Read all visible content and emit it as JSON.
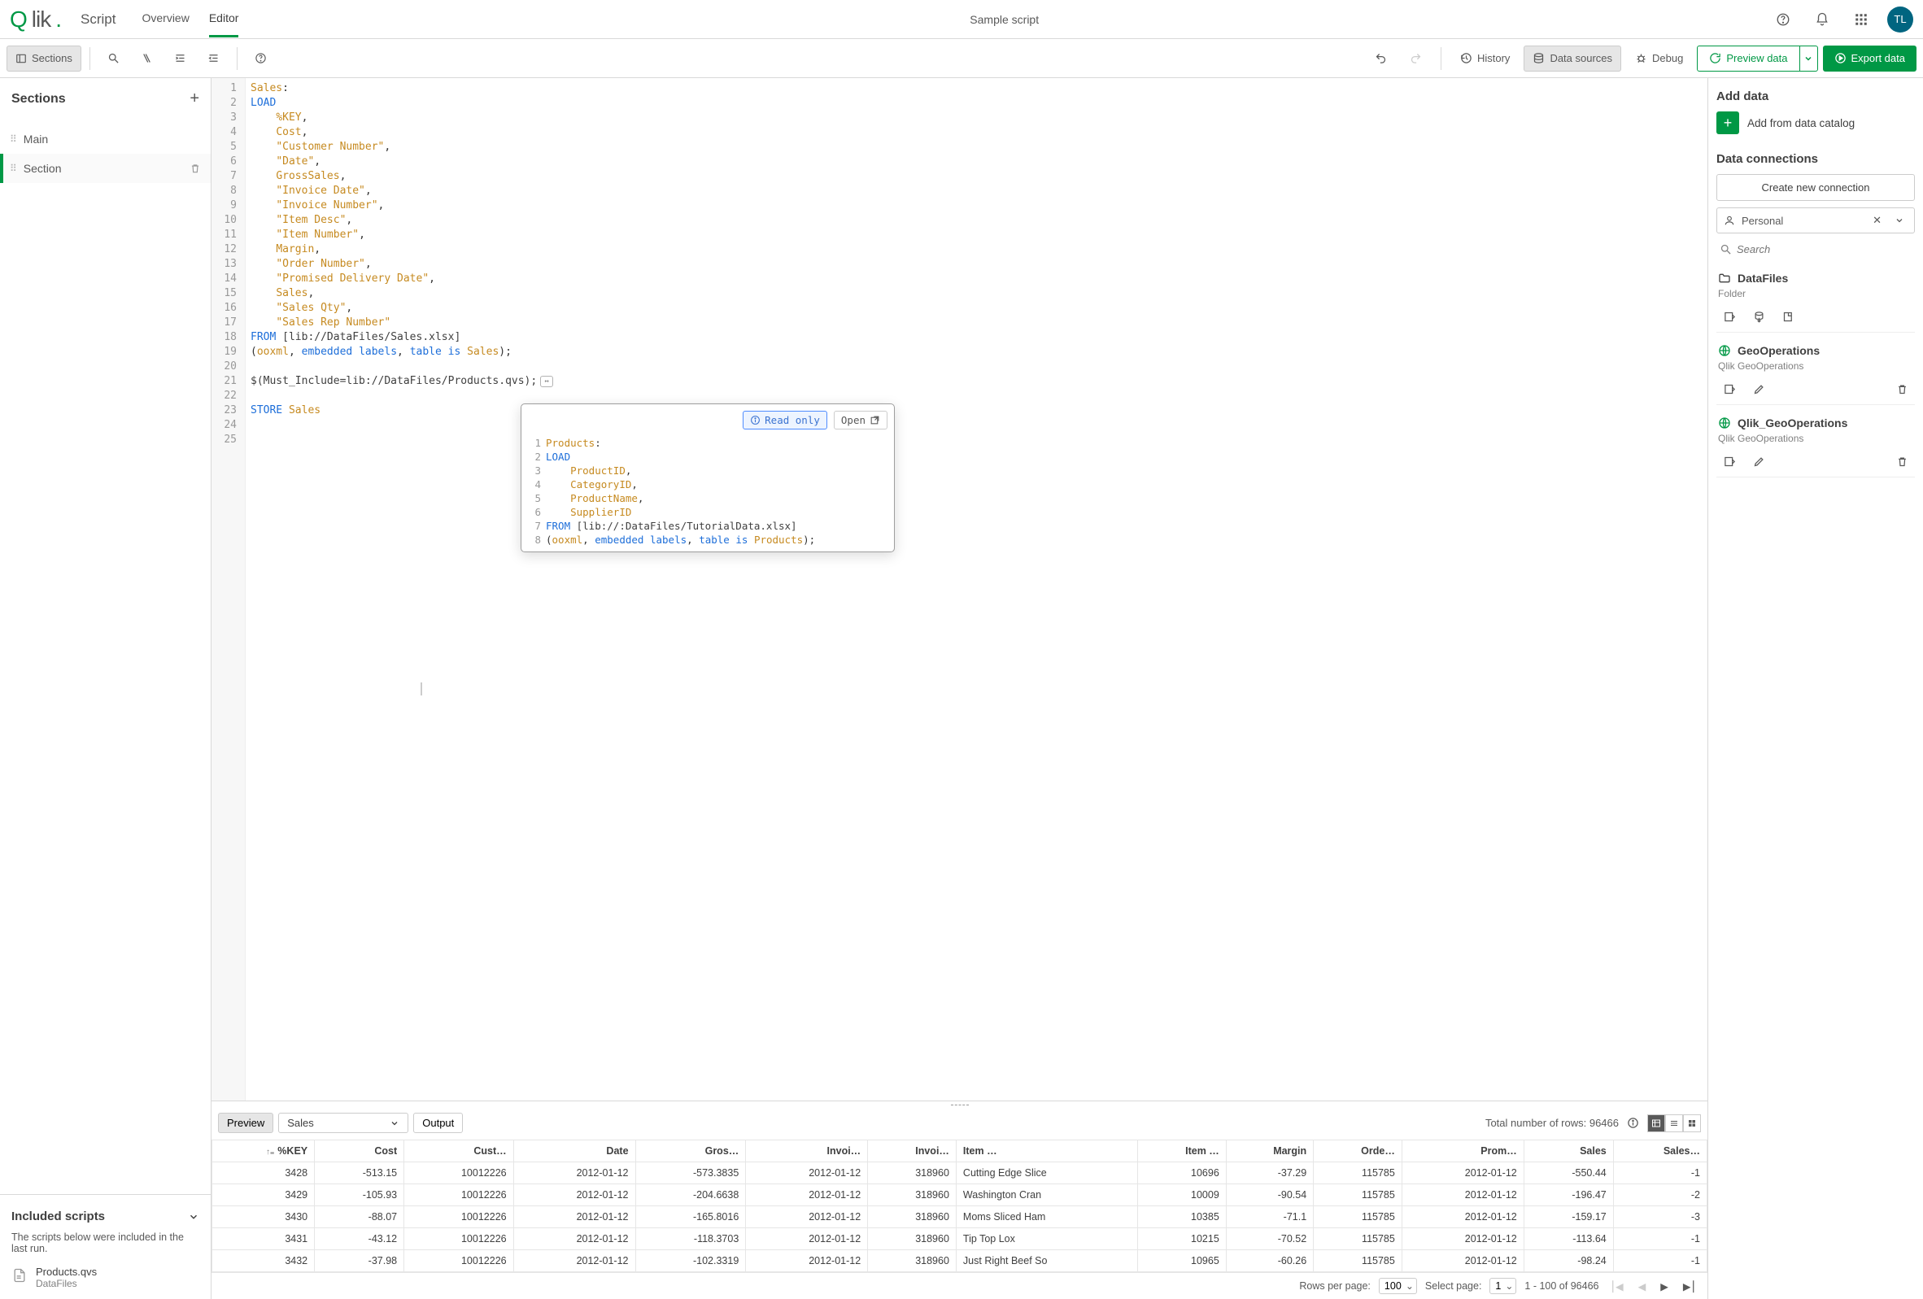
{
  "brand": {
    "q": "Q",
    "rest": "lik",
    "dot": "."
  },
  "script_label": "Script",
  "top_tabs": {
    "overview": "Overview",
    "editor": "Editor"
  },
  "page_title": "Sample script",
  "avatar": "TL",
  "toolbar": {
    "sections_btn": "Sections",
    "history": "History",
    "data_sources": "Data sources",
    "debug": "Debug",
    "preview_data": "Preview data",
    "export_data": "Export data"
  },
  "sections_panel": {
    "title": "Sections",
    "items": [
      "Main",
      "Section"
    ]
  },
  "included": {
    "title": "Included scripts",
    "desc": "The scripts below were included in the last run.",
    "item_name": "Products.qvs",
    "item_sub": "DataFiles"
  },
  "editor_lines": [
    [
      [
        "ident",
        "Sales"
      ],
      [
        "punct",
        ":"
      ]
    ],
    [
      [
        "kw",
        "LOAD"
      ]
    ],
    [
      [
        "",
        "    "
      ],
      [
        "ident",
        "%KEY"
      ],
      [
        "punct",
        ","
      ]
    ],
    [
      [
        "",
        "    "
      ],
      [
        "ident",
        "Cost"
      ],
      [
        "punct",
        ","
      ]
    ],
    [
      [
        "",
        "    "
      ],
      [
        "str",
        "\"Customer Number\""
      ],
      [
        "punct",
        ","
      ]
    ],
    [
      [
        "",
        "    "
      ],
      [
        "str",
        "\"Date\""
      ],
      [
        "punct",
        ","
      ]
    ],
    [
      [
        "",
        "    "
      ],
      [
        "ident",
        "GrossSales"
      ],
      [
        "punct",
        ","
      ]
    ],
    [
      [
        "",
        "    "
      ],
      [
        "str",
        "\"Invoice Date\""
      ],
      [
        "punct",
        ","
      ]
    ],
    [
      [
        "",
        "    "
      ],
      [
        "str",
        "\"Invoice Number\""
      ],
      [
        "punct",
        ","
      ]
    ],
    [
      [
        "",
        "    "
      ],
      [
        "str",
        "\"Item Desc\""
      ],
      [
        "punct",
        ","
      ]
    ],
    [
      [
        "",
        "    "
      ],
      [
        "str",
        "\"Item Number\""
      ],
      [
        "punct",
        ","
      ]
    ],
    [
      [
        "",
        "    "
      ],
      [
        "ident",
        "Margin"
      ],
      [
        "punct",
        ","
      ]
    ],
    [
      [
        "",
        "    "
      ],
      [
        "str",
        "\"Order Number\""
      ],
      [
        "punct",
        ","
      ]
    ],
    [
      [
        "",
        "    "
      ],
      [
        "str",
        "\"Promised Delivery Date\""
      ],
      [
        "punct",
        ","
      ]
    ],
    [
      [
        "",
        "    "
      ],
      [
        "ident",
        "Sales"
      ],
      [
        "punct",
        ","
      ]
    ],
    [
      [
        "",
        "    "
      ],
      [
        "str",
        "\"Sales Qty\""
      ],
      [
        "punct",
        ","
      ]
    ],
    [
      [
        "",
        "    "
      ],
      [
        "str",
        "\"Sales Rep Number\""
      ]
    ],
    [
      [
        "kw",
        "FROM"
      ],
      [
        "",
        " [lib://DataFiles/Sales.xlsx]"
      ]
    ],
    [
      [
        "punct",
        "("
      ],
      [
        "ident",
        "ooxml"
      ],
      [
        "punct",
        ", "
      ],
      [
        "kw",
        "embedded labels"
      ],
      [
        "punct",
        ", "
      ],
      [
        "kw",
        "table is"
      ],
      [
        "",
        " "
      ],
      [
        "ident",
        "Sales"
      ],
      [
        "punct",
        ");"
      ]
    ],
    [
      [
        "",
        ""
      ]
    ],
    [
      [
        "",
        "$(Must_Include=lib://DataFiles/Products.qvs);"
      ],
      [
        "@expand",
        ""
      ]
    ],
    [
      [
        "",
        ""
      ]
    ],
    [
      [
        "kw",
        "STORE"
      ],
      [
        "",
        " "
      ],
      [
        "ident",
        "Sales"
      ]
    ],
    [
      [
        "",
        ""
      ]
    ],
    [
      [
        "",
        ""
      ]
    ]
  ],
  "popover": {
    "read_only": "Read only",
    "open": "Open",
    "lines": [
      [
        [
          "ident",
          "Products"
        ],
        [
          "punct",
          ":"
        ]
      ],
      [
        [
          "kw",
          "LOAD"
        ]
      ],
      [
        [
          "",
          "    "
        ],
        [
          "ident",
          "ProductID"
        ],
        [
          "punct",
          ","
        ]
      ],
      [
        [
          "",
          "    "
        ],
        [
          "ident",
          "CategoryID"
        ],
        [
          "punct",
          ","
        ]
      ],
      [
        [
          "",
          "    "
        ],
        [
          "ident",
          "ProductName"
        ],
        [
          "punct",
          ","
        ]
      ],
      [
        [
          "",
          "    "
        ],
        [
          "ident",
          "SupplierID"
        ]
      ],
      [
        [
          "kw",
          "FROM"
        ],
        [
          "",
          " [lib://:DataFiles/TutorialData.xlsx]"
        ]
      ],
      [
        [
          "punct",
          "("
        ],
        [
          "ident",
          "ooxml"
        ],
        [
          "punct",
          ", "
        ],
        [
          "kw",
          "embedded labels"
        ],
        [
          "punct",
          ", "
        ],
        [
          "kw",
          "table is"
        ],
        [
          "",
          " "
        ],
        [
          "ident",
          "Products"
        ],
        [
          "punct",
          ");"
        ]
      ]
    ]
  },
  "right": {
    "add_data": "Add data",
    "catalog": "Add from data catalog",
    "dc_title": "Data connections",
    "create_new": "Create new connection",
    "conn_name": "Personal",
    "search_ph": "Search",
    "datafiles": "DataFiles",
    "datafiles_sub": "Folder",
    "geo1": "GeoOperations",
    "geo_sub": "Qlik GeoOperations",
    "geo2": "Qlik_GeoOperations"
  },
  "preview": {
    "preview_btn": "Preview",
    "table_sel": "Sales",
    "output_btn": "Output",
    "total_label": "Total number of rows: ",
    "total_value": "96466",
    "columns": [
      "%KEY",
      "Cost",
      "Cust…",
      "Date",
      "Gros…",
      "Invoi…",
      "Invoi…",
      "Item …",
      "Item …",
      "Margin",
      "Orde…",
      "Prom…",
      "Sales",
      "Sales…"
    ],
    "rows": [
      [
        "3428",
        "-513.15",
        "10012226",
        "2012-01-12",
        "-573.3835",
        "2012-01-12",
        "318960",
        "Cutting Edge Slice",
        "10696",
        "-37.29",
        "115785",
        "2012-01-12",
        "-550.44",
        "-1"
      ],
      [
        "3429",
        "-105.93",
        "10012226",
        "2012-01-12",
        "-204.6638",
        "2012-01-12",
        "318960",
        "Washington Cran",
        "10009",
        "-90.54",
        "115785",
        "2012-01-12",
        "-196.47",
        "-2"
      ],
      [
        "3430",
        "-88.07",
        "10012226",
        "2012-01-12",
        "-165.8016",
        "2012-01-12",
        "318960",
        "Moms Sliced Ham",
        "10385",
        "-71.1",
        "115785",
        "2012-01-12",
        "-159.17",
        "-3"
      ],
      [
        "3431",
        "-43.12",
        "10012226",
        "2012-01-12",
        "-118.3703",
        "2012-01-12",
        "318960",
        "Tip Top Lox",
        "10215",
        "-70.52",
        "115785",
        "2012-01-12",
        "-113.64",
        "-1"
      ],
      [
        "3432",
        "-37.98",
        "10012226",
        "2012-01-12",
        "-102.3319",
        "2012-01-12",
        "318960",
        "Just Right Beef So",
        "10965",
        "-60.26",
        "115785",
        "2012-01-12",
        "-98.24",
        "-1"
      ]
    ],
    "rows_per_page": "Rows per page:",
    "rpp_val": "100",
    "select_page": "Select page:",
    "sp_val": "1",
    "range": "1 - 100 of 96466"
  }
}
